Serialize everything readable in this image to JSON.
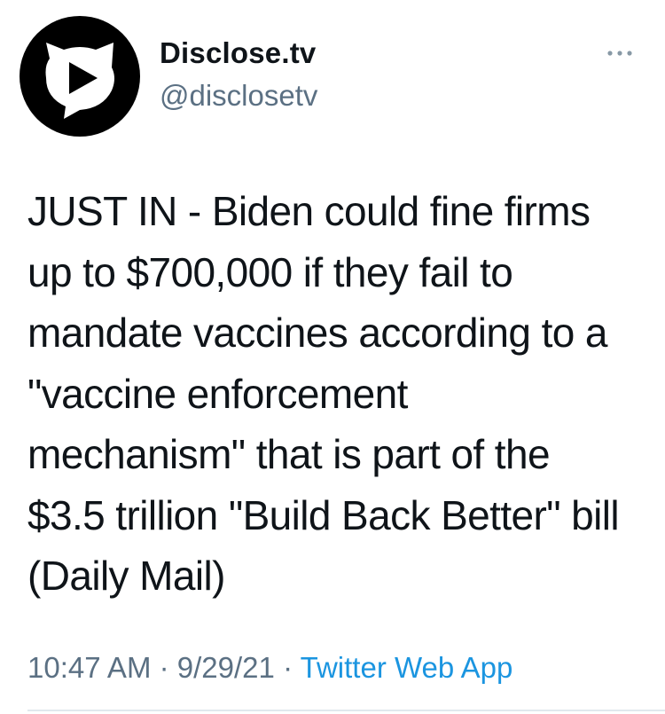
{
  "tweet": {
    "author": {
      "display_name": "Disclose.tv",
      "handle": "@disclosetv",
      "avatar_icon": "play-button-speech-bubble-logo"
    },
    "more_icon": "more-options-icon",
    "text": "JUST IN - Biden could fine firms\nup to $700,000 if they fail to\nmandate vaccines according to a\n\"vaccine enforcement\nmechanism\" that is part of the\n$3.5 trillion \"Build Back Better\" bill\n(Daily Mail)",
    "time": "10:47 AM",
    "date": "9/29/21",
    "separator": "·",
    "source": "Twitter Web App"
  },
  "colors": {
    "text": "#0f1419",
    "secondary": "#5b7083",
    "link": "#1b95e0",
    "divider": "#e1e8ed",
    "avatar_bg": "#000000"
  }
}
